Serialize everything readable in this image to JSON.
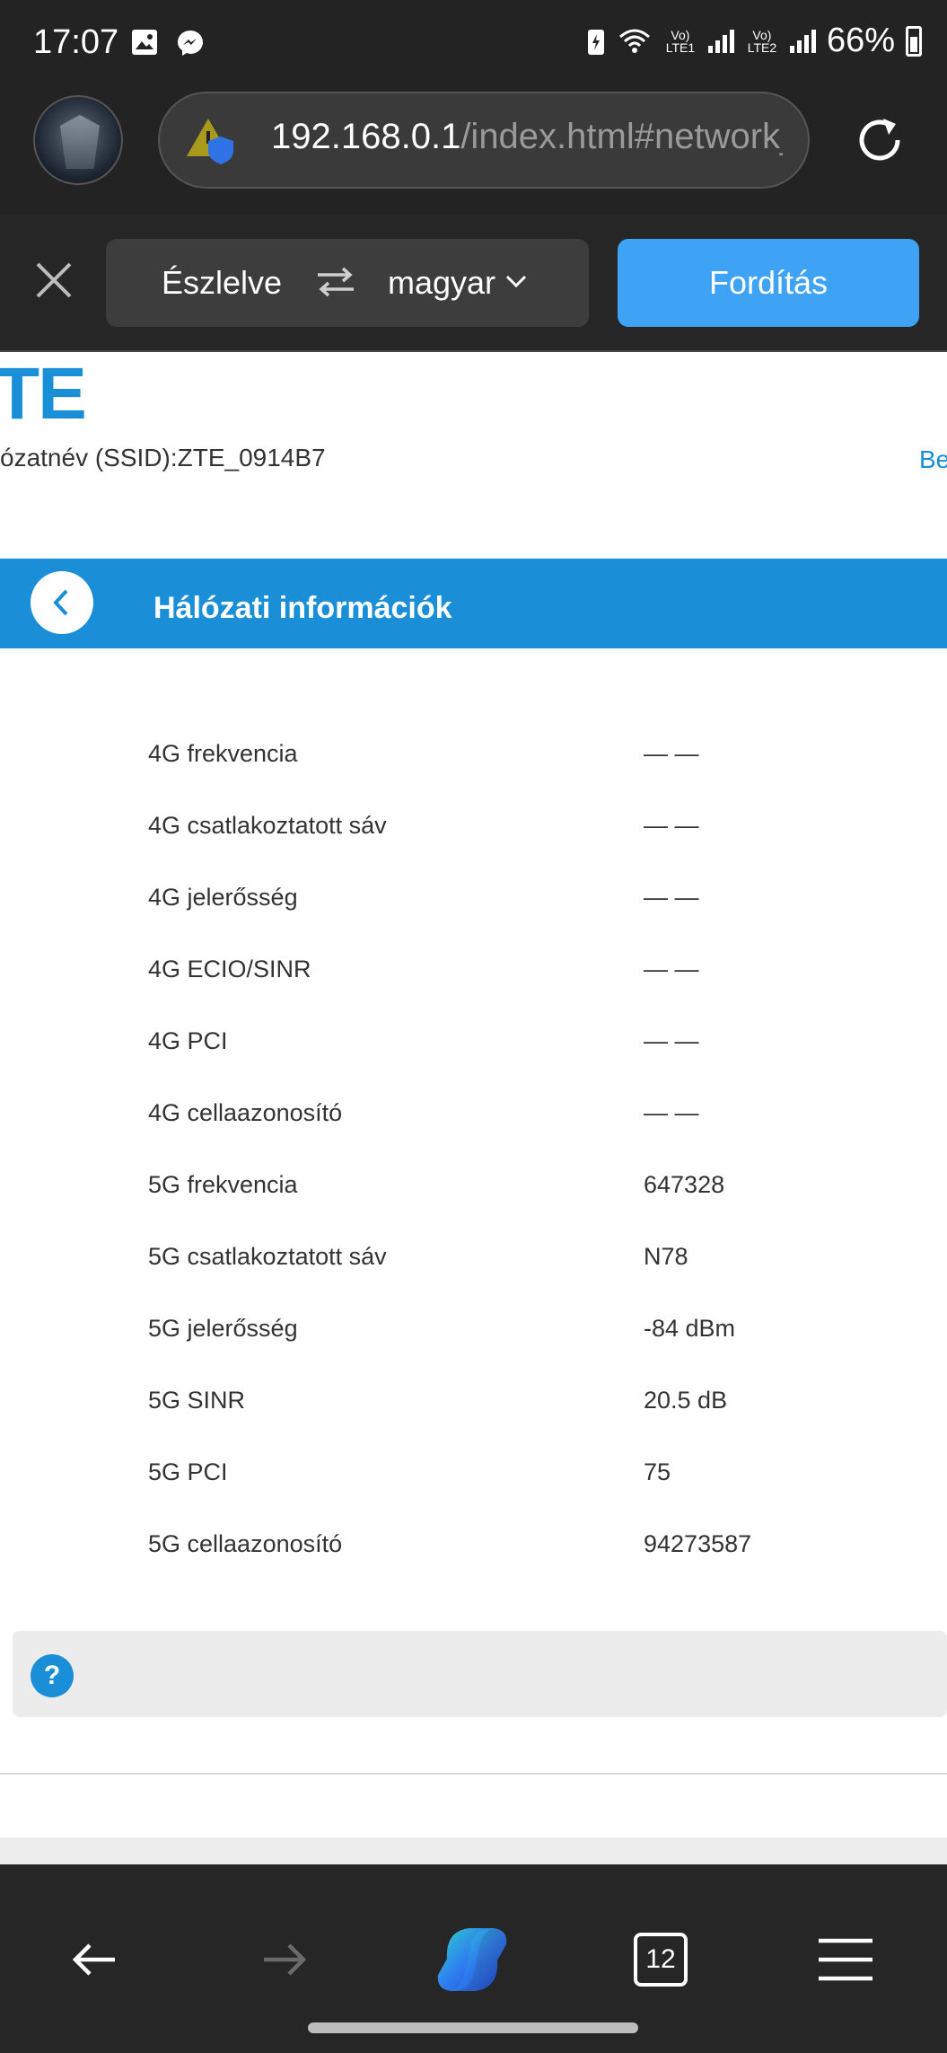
{
  "status_bar": {
    "time": "17:07",
    "sim1_label": "Vo) LTE1",
    "sim2_label": "Vo) LTE2",
    "battery": "66%"
  },
  "browser": {
    "url_host": "192.168.0.1",
    "url_path": "/index.html#network_",
    "icons": [
      "security-warning-icon",
      "reload-icon",
      "avatar"
    ]
  },
  "translate_bar": {
    "detected": "Észlelve",
    "target_language": "magyar",
    "translate_button": "Fordítás"
  },
  "page": {
    "logo": "TE",
    "ssid_line": "ózatnév (SSID):ZTE_0914B7",
    "right_link": "Be",
    "section_title": "Hálózati információk",
    "rows": [
      {
        "label": "4G frekvencia",
        "value": "— —"
      },
      {
        "label": "4G csatlakoztatott sáv",
        "value": "— —"
      },
      {
        "label": "4G jelerősség",
        "value": "— —"
      },
      {
        "label": "4G ECIO/SINR",
        "value": "— —"
      },
      {
        "label": "4G PCI",
        "value": "— —"
      },
      {
        "label": "4G cellaazonosító",
        "value": "— —"
      },
      {
        "label": "5G frekvencia",
        "value": "647328"
      },
      {
        "label": "5G csatlakoztatott sáv",
        "value": "N78"
      },
      {
        "label": "5G jelerősség",
        "value": "-84 dBm"
      },
      {
        "label": "5G SINR",
        "value": "20.5 dB"
      },
      {
        "label": "5G PCI",
        "value": "75"
      },
      {
        "label": "5G cellaazonosító",
        "value": "94273587"
      }
    ],
    "help_icon_text": "?"
  },
  "bottom_nav": {
    "tabs_count": "12"
  },
  "colors": {
    "accent": "#1a8fd8",
    "translate_button": "#3ea3f5",
    "chrome_bg": "#232323"
  }
}
